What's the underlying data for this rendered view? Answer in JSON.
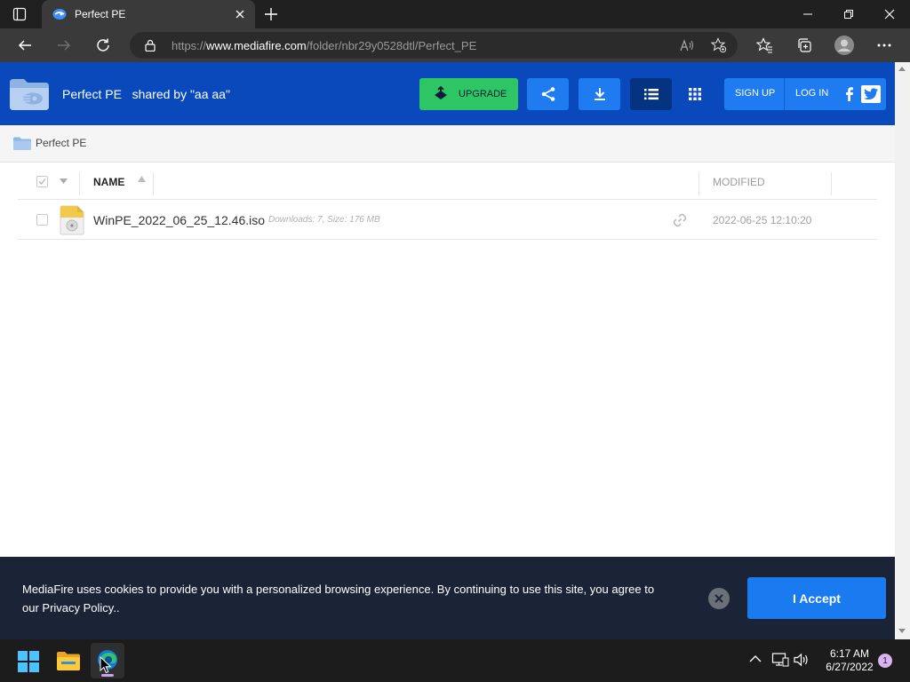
{
  "browser": {
    "tab_title": "Perfect PE",
    "url_prefix": "https://",
    "url_domain": "www.mediafire.com",
    "url_path": "/folder/nbr29y0528dtl/Perfect_PE"
  },
  "header": {
    "title": "Perfect PE",
    "shared_by": "shared by \"aa aa\"",
    "upgrade_label": "UPGRADE",
    "signup_label": "SIGN UP",
    "login_label": "LOG IN"
  },
  "breadcrumb": {
    "folder": "Perfect PE"
  },
  "columns": {
    "name": "NAME",
    "modified": "MODIFIED"
  },
  "files": [
    {
      "name": "WinPE_2022_06_25_12.46.iso",
      "meta": "Downloads: 7, Size: 176 MB",
      "modified": "2022-06-25 12:10:20"
    }
  ],
  "cookie": {
    "text": "MediaFire uses cookies to provide you with a personalized browsing experience. By continuing to use this site, you agree to our Privacy Policy..",
    "accept_label": "I Accept"
  },
  "taskbar": {
    "time": "6:17 AM",
    "date": "6/27/2022",
    "notification_count": "1"
  },
  "colors": {
    "brand_blue": "#0a49bb",
    "accent_blue": "#1f7cf0",
    "upgrade_green": "#2ec665"
  }
}
